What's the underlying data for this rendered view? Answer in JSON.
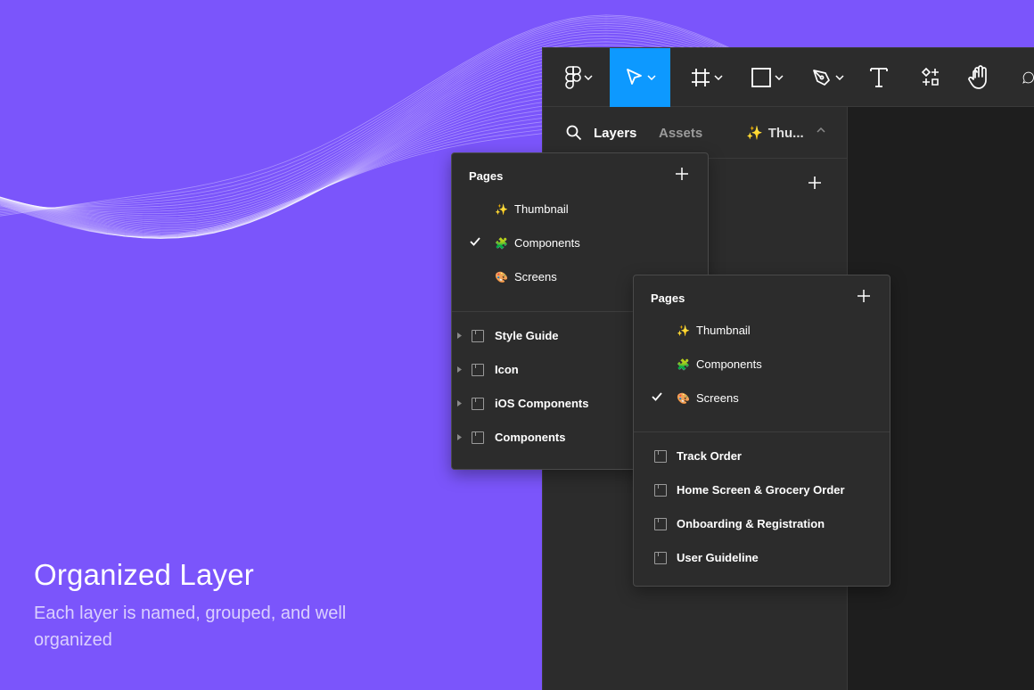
{
  "promo": {
    "title": "Organized Layer",
    "subtitle": "Each layer is named, grouped, and well organized"
  },
  "toolbar": {
    "tools": [
      {
        "name": "figma-menu",
        "icon": "figma-logo-icon"
      },
      {
        "name": "move",
        "icon": "cursor-arrow-icon",
        "active": true
      },
      {
        "name": "frame",
        "icon": "frame-hash-icon"
      },
      {
        "name": "shape",
        "icon": "rectangle-icon"
      },
      {
        "name": "pen",
        "icon": "pen-nib-icon"
      },
      {
        "name": "text",
        "icon": "text-t-icon"
      },
      {
        "name": "resources",
        "icon": "components-grid-icon"
      },
      {
        "name": "hand",
        "icon": "hand-icon"
      },
      {
        "name": "comment",
        "icon": "comment-bubble-icon"
      }
    ]
  },
  "sidebar": {
    "tabs": {
      "layers": "Layers",
      "assets": "Assets"
    },
    "current_page": {
      "emoji": "✨",
      "label": "Thu..."
    }
  },
  "panel_a": {
    "header": "Pages",
    "pages": [
      {
        "emoji": "✨",
        "label": "Thumbnail",
        "checked": false
      },
      {
        "emoji": "🧩",
        "label": "Components",
        "checked": true
      },
      {
        "emoji": "🎨",
        "label": "Screens",
        "checked": false
      }
    ],
    "frames": [
      "Style Guide",
      "Icon",
      "iOS Components",
      "Components"
    ]
  },
  "panel_b": {
    "header": "Pages",
    "pages": [
      {
        "emoji": "✨",
        "label": "Thumbnail",
        "checked": false
      },
      {
        "emoji": "🧩",
        "label": "Components",
        "checked": false
      },
      {
        "emoji": "🎨",
        "label": "Screens",
        "checked": true
      }
    ],
    "frames": [
      "Track Order",
      "Home Screen & Grocery Order",
      "Onboarding & Registration",
      "User Guideline"
    ]
  },
  "colors": {
    "background": "#7B55FB",
    "panel": "#2C2C2C",
    "canvas": "#1E1E1E",
    "active_tool": "#0D99FF",
    "components_icon": "#1BC47D",
    "thumbnail_icon": "#F5C242",
    "screens_icon": "#E97A7A"
  }
}
